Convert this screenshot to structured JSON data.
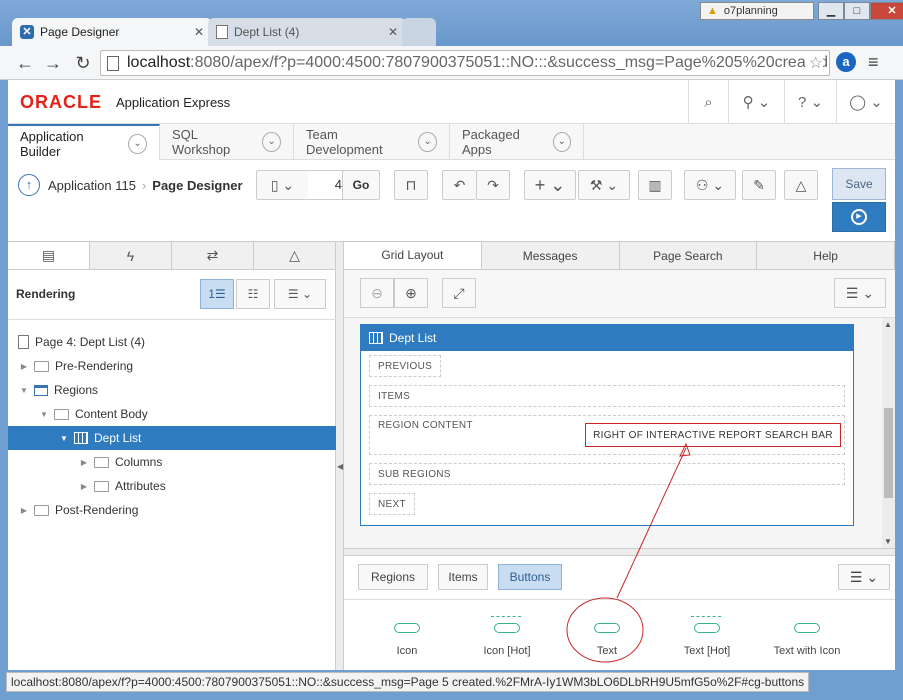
{
  "browser": {
    "tabs": [
      {
        "label": "Page Designer",
        "icon": "apex-x-icon",
        "active": true
      },
      {
        "label": "Dept List (4)",
        "icon": "document-icon",
        "active": false
      }
    ],
    "window_user": "o7planning",
    "url_host": "localhost",
    "url_rest": ":8080/apex/f?p=4000:4500:7807900375051::NO:::&success_msg=Page%205%20created",
    "extension_letter": "a"
  },
  "header": {
    "brand": "ORACLE",
    "product": "Application Express"
  },
  "nav": {
    "tabs": [
      {
        "label": "Application Builder"
      },
      {
        "label": "SQL Workshop"
      },
      {
        "label": "Team Development"
      },
      {
        "label": "Packaged Apps"
      }
    ]
  },
  "toolbar": {
    "breadcrumb_parent": "Application 115",
    "breadcrumb_current": "Page Designer",
    "page_number": "4",
    "go_label": "Go",
    "save_label": "Save"
  },
  "left_pane": {
    "rendering_label": "Rendering",
    "tree": {
      "page": "Page 4: Dept List (4)",
      "pre_rendering": "Pre-Rendering",
      "regions": "Regions",
      "content_body": "Content Body",
      "dept_list": "Dept List",
      "columns": "Columns",
      "attributes": "Attributes",
      "post_rendering": "Post-Rendering"
    }
  },
  "center": {
    "tabs": [
      "Grid Layout",
      "Messages",
      "Page Search",
      "Help"
    ],
    "region_title": "Dept List",
    "positions": {
      "previous": "PREVIOUS",
      "items": "ITEMS",
      "region_content": "REGION CONTENT",
      "right_of_search": "RIGHT OF INTERACTIVE REPORT SEARCH BAR",
      "sub_regions": "SUB REGIONS",
      "next": "NEXT"
    },
    "gallery_tabs": [
      "Regions",
      "Items",
      "Buttons"
    ],
    "gallery_items": [
      "Icon",
      "Icon [Hot]",
      "Text",
      "Text [Hot]",
      "Text with Icon"
    ]
  },
  "status_bar": "localhost:8080/apex/f?p=4000:4500:7807900375051::NO::&success_msg=Page 5 created.%2FMrA-Iy1WM3bLO6DLbRH9U5mfG5o%2F#cg-buttons",
  "colors": {
    "apex_blue": "#2f7bbf",
    "oracle_red": "#e2231a",
    "annotation_red": "#c92626",
    "button_green": "#3bb08f"
  }
}
